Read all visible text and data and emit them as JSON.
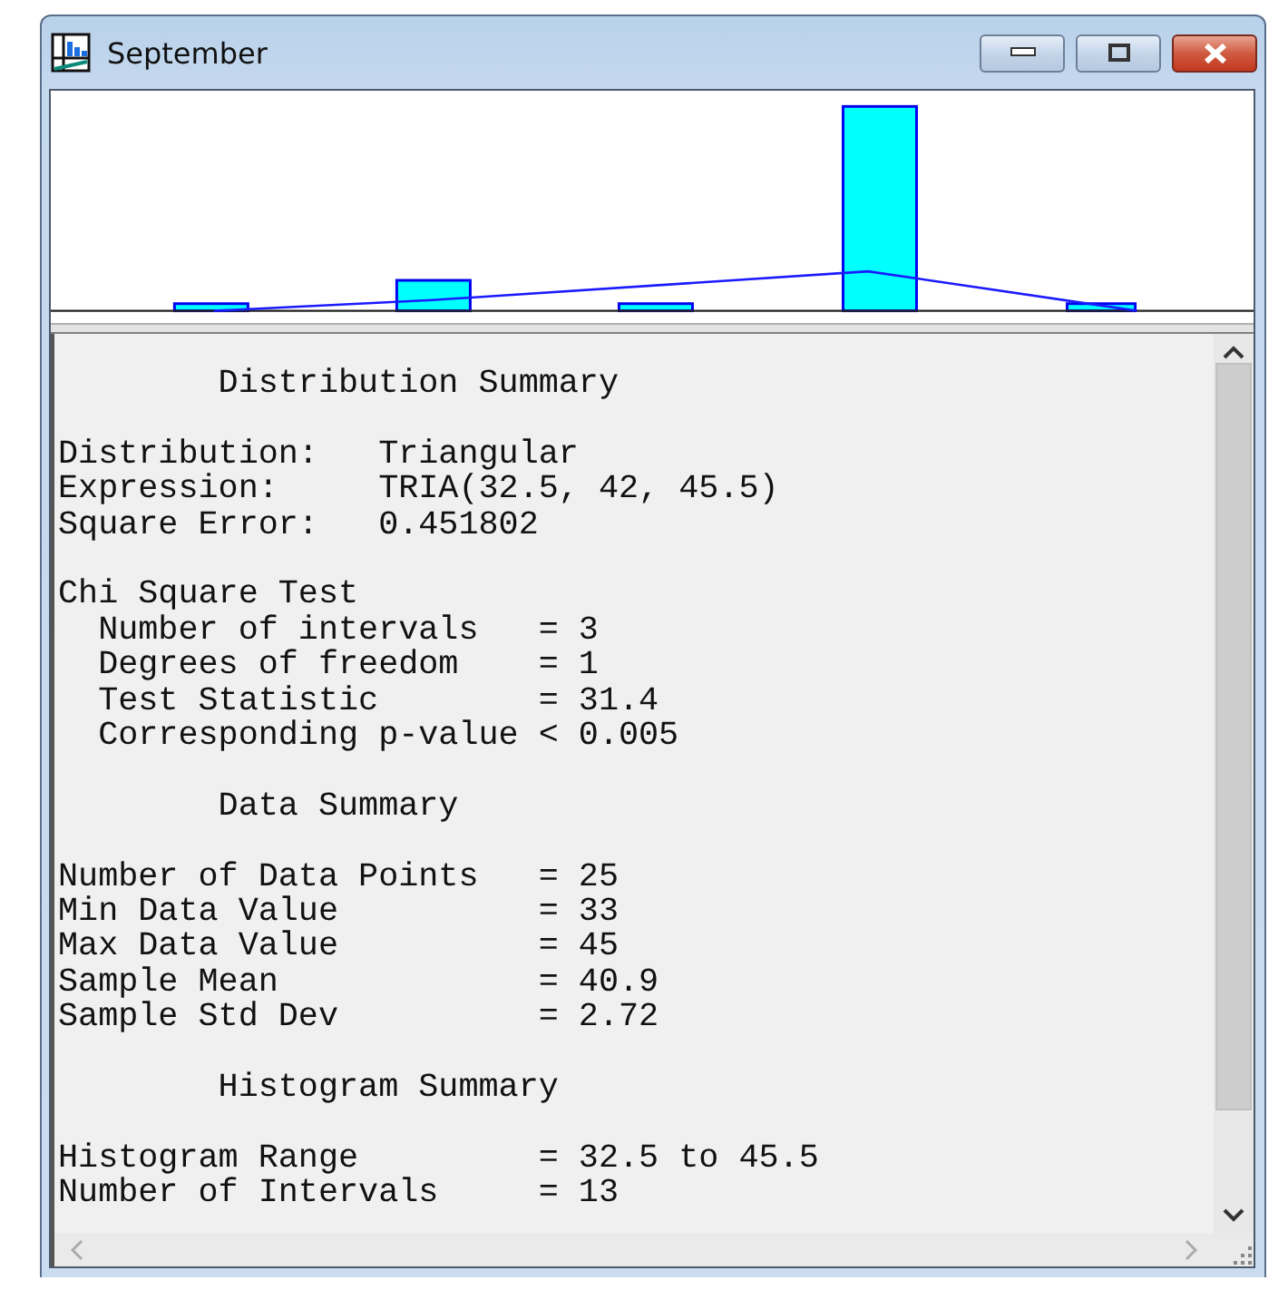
{
  "window": {
    "title": "September"
  },
  "report": [
    {
      "kind": "heading",
      "text": "Distribution Summary"
    },
    {
      "kind": "fields",
      "rows": [
        {
          "label": "Distribution:",
          "value": "Triangular"
        },
        {
          "label": "Expression:",
          "value": "TRIA(32.5, 42, 45.5)"
        },
        {
          "label": "Square Error:",
          "value": "0.451802"
        }
      ]
    },
    {
      "kind": "group",
      "title": "Chi Square Test",
      "rows": [
        {
          "label": "Number of intervals",
          "value": "= 3"
        },
        {
          "label": "Degrees of freedom",
          "value": "= 1"
        },
        {
          "label": "Test Statistic",
          "value": "= 31.4"
        },
        {
          "label": "Corresponding p-value",
          "value": "< 0.005"
        }
      ]
    },
    {
      "kind": "heading",
      "text": "Data Summary"
    },
    {
      "kind": "stats",
      "rows": [
        {
          "label": "Number of Data Points",
          "value": "= 25"
        },
        {
          "label": "Min Data Value",
          "value": "= 33"
        },
        {
          "label": "Max Data Value",
          "value": "= 45"
        },
        {
          "label": "Sample Mean",
          "value": "= 40.9"
        },
        {
          "label": "Sample Std Dev",
          "value": "= 2.72"
        }
      ]
    },
    {
      "kind": "heading",
      "text": "Histogram Summary"
    },
    {
      "kind": "stats",
      "rows": [
        {
          "label": "Histogram Range",
          "value": "= 32.5 to 45.5"
        },
        {
          "label": "Number of Intervals",
          "value": "= 13"
        }
      ]
    }
  ]
}
